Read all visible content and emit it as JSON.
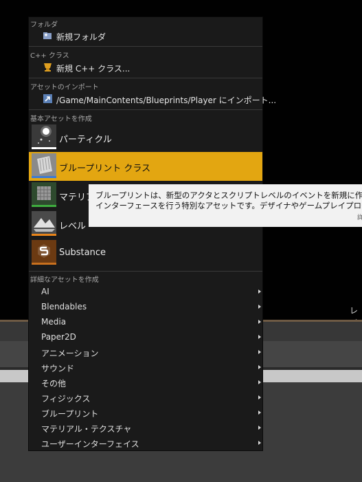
{
  "background": {
    "right_label": "レベ"
  },
  "menu": {
    "sections": {
      "folder": "フォルダ",
      "cpp": "C++ クラス",
      "import": "アセットのインポート",
      "basic": "基本アセットを作成",
      "advanced": "詳細なアセットを作成"
    },
    "items": {
      "new_folder": "新規フォルダ",
      "new_cpp": "新規 C++ クラス...",
      "import_to": "/Game/MainContents/Blueprints/Player にインポート..."
    },
    "basic_assets": [
      {
        "label": "パーティクル",
        "icon": "particle-icon",
        "bar_color": "#ffffff"
      },
      {
        "label": "ブループリント クラス",
        "icon": "blueprint-icon",
        "bar_color": "#3d7bd4"
      },
      {
        "label": "マテリアル",
        "icon": "material-icon",
        "bar_color": "#3fae3f"
      },
      {
        "label": "レベル",
        "icon": "level-icon",
        "bar_color": "#e8841a"
      },
      {
        "label": "Substance",
        "icon": "substance-icon",
        "bar_color": "#c8701e"
      }
    ],
    "advanced_assets": [
      {
        "label": "AI"
      },
      {
        "label": "Blendables"
      },
      {
        "label": "Media"
      },
      {
        "label": "Paper2D"
      },
      {
        "label": "アニメーション"
      },
      {
        "label": "サウンド"
      },
      {
        "label": "その他"
      },
      {
        "label": "フィジックス"
      },
      {
        "label": "ブループリント"
      },
      {
        "label": "マテリアル・テクスチャ"
      },
      {
        "label": "ユーザーインターフェイス"
      }
    ]
  },
  "tooltip": {
    "line1": "ブループリントは、新型のアクタとスクリプトレベルのイベントを新規に作成す",
    "line2": "インターフェースを行う特別なアセットです。デザイナやゲームプレイプログラ",
    "more": "詳"
  },
  "colors": {
    "highlight": "#e3a611",
    "menu_bg": "#1a1a1a"
  }
}
